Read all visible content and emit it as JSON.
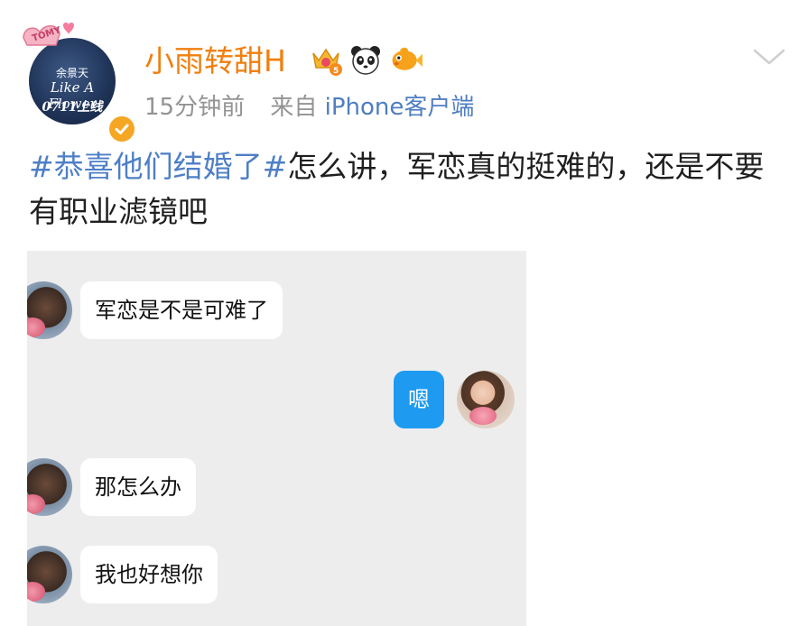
{
  "post": {
    "author": {
      "name": "小雨转甜H",
      "avatar_sticker_text": "TOMY",
      "avatar_text_line1": "余景天",
      "avatar_text_line2": "Like A Flower",
      "avatar_text_line3": "0711上线",
      "badges": [
        "crown-level-5-icon",
        "panda-icon",
        "fish-icon"
      ],
      "verified_icon": "verified-check-icon"
    },
    "meta": {
      "time": "15分钟前",
      "source_prefix": "来自",
      "source": "iPhone客户端"
    },
    "menu_icon": "chevron-down-icon",
    "content": {
      "topic": "#恭喜他们结婚了#",
      "text": "怎么讲，军恋真的挺难的，还是不要有职业滤镜吧"
    }
  },
  "chat": {
    "messages": [
      {
        "side": "left",
        "text": "军恋是不是可难了",
        "avatar": "boy-avatar"
      },
      {
        "side": "right",
        "text": "嗯",
        "avatar": "girl-avatar"
      },
      {
        "side": "left",
        "text": "那怎么办",
        "avatar": "boy-avatar"
      },
      {
        "side": "left",
        "text": "我也好想你",
        "avatar": "boy-avatar"
      }
    ]
  },
  "colors": {
    "username": "#f07f0f",
    "link": "#4e7fc7",
    "meta": "#939393",
    "chat_bg": "#ededed",
    "my_bubble": "#1e9bf0"
  }
}
